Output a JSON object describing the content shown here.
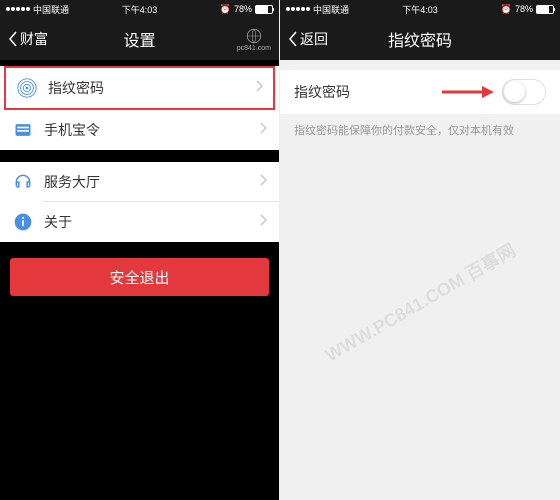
{
  "status_bar": {
    "carrier": "中国联通",
    "time": "下午4:03",
    "battery_pct": "78%",
    "alarm": "⏰"
  },
  "screen1": {
    "nav": {
      "back_label": "财富",
      "title": "设置",
      "logo_text": "pc841.com"
    },
    "items": {
      "fingerprint": "指纹密码",
      "mobile_token": "手机宝令",
      "service_hall": "服务大厅",
      "about": "关于"
    },
    "logout": "安全退出"
  },
  "screen2": {
    "nav": {
      "back_label": "返回",
      "title": "指纹密码"
    },
    "toggle_label": "指纹密码",
    "hint": "指纹密码能保障你的付款安全，仅对本机有效"
  },
  "watermark": "WWW.PC841.COM 百事网"
}
